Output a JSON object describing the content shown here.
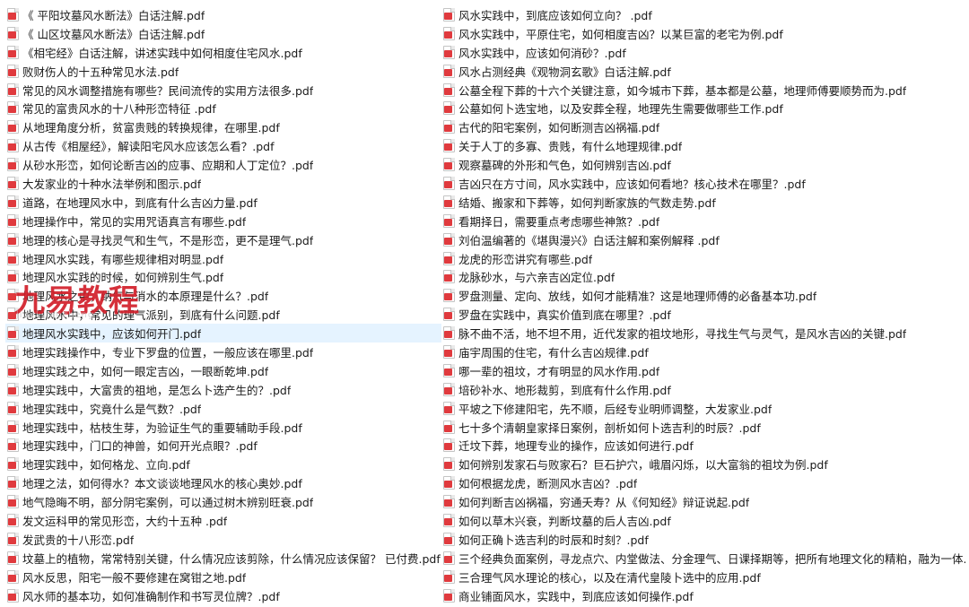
{
  "files": {
    "left": [
      "《 平阳坟墓风水断法》白话注解.pdf",
      "《 山区坟墓风水断法》白话注解.pdf",
      "《相宅经》白话注解，讲述实践中如何相度住宅风水.pdf",
      "败财伤人的十五种常见水法.pdf",
      "常见的风水调整措施有哪些？民间流传的实用方法很多.pdf",
      "常见的富贵风水的十八种形峦特征 .pdf",
      "从地理角度分析，贫富贵贱的转换规律，在哪里.pdf",
      "从古传《相屋经》，解读阳宅风水应该怎么看？.pdf",
      "从砂水形峦，如何论断吉凶的应事、应期和人丁定位？.pdf",
      "大发家业的十种水法举例和图示.pdf",
      "道路，在地理风水中，到底有什么吉凶力量.pdf",
      "地理操作中，常见的实用咒语真言有哪些.pdf",
      "地理的核心是寻找灵气和生气，不是形峦，更不是理气.pdf",
      "地理风水实践，有哪些规律相对明显.pdf",
      "地理风水实践的时候，如何辨别生气.pdf",
      "地理风水之中，纳气与消水的本原理是什么？.pdf",
      "地理风水中，常见的理气派别，到底有什么问题.pdf",
      "地理风水实践中，应该如何开门.pdf",
      "地理实践操作中，专业下罗盘的位置，一般应该在哪里.pdf",
      "地理实践之中，如何一眼定吉凶，一眼断乾坤.pdf",
      "地理实践中，大富贵的祖地，是怎么卜选产生的？.pdf",
      "地理实践中，究竟什么是气数？.pdf",
      "地理实践中，枯枝生芽，为验证生气的重要辅助手段.pdf",
      "地理实践中，门口的神兽，如何开光点眼？.pdf",
      "地理实践中，如何格龙、立向.pdf",
      "地理之法，如何得水？本文谈谈地理风水的核心奥妙.pdf",
      "地气隐晦不明，部分阴宅案例，可以通过树木辨别旺衰.pdf",
      "发文运科甲的常见形峦，大约十五种 .pdf",
      "发武贵的十八形峦.pdf",
      "坟墓上的植物，常常特别关键，什么情况应该剪除，什么情况应该保留？ 已付费.pdf",
      "风水反思，阳宅一般不要修建在窝钳之地.pdf",
      "风水师的基本功，如何准确制作和书写灵位牌？.pdf"
    ],
    "right": [
      "风水实践中，到底应该如何立向？ .pdf",
      "风水实践中，平原住宅，如何相度吉凶？以某巨富的老宅为例.pdf",
      "风水实践中，应该如何消砂？.pdf",
      "风水占测经典《观物洞玄歌》白话注解.pdf",
      "公墓全程下葬的十六个关键注意，如今城市下葬，基本都是公墓，地理师傅要顺势而为.pdf",
      "公墓如何卜选宝地，以及安葬全程，地理先生需要做哪些工作.pdf",
      "古代的阳宅案例，如何断测吉凶祸福.pdf",
      "关于人丁的多寡、贵贱，有什么地理规律.pdf",
      "观察墓碑的外形和气色，如何辨别吉凶.pdf",
      "吉凶只在方寸间，风水实践中，应该如何看地？核心技术在哪里？.pdf",
      "结婚、搬家和下葬等，如何判断家族的气数走势.pdf",
      "看期择日，需要重点考虑哪些神煞？.pdf",
      "刘伯温编著的《堪舆漫兴》白话注解和案例解释 .pdf",
      "龙虎的形峦讲究有哪些.pdf",
      "龙脉砂水，与六亲吉凶定位.pdf",
      "罗盘测量、定向、放线，如何才能精准？这是地理师傅的必备基本功.pdf",
      "罗盘在实践中，真实价值到底在哪里？.pdf",
      "脉不曲不活，地不坦不用，近代发家的祖坟地形，寻找生气与灵气，是风水吉凶的关键.pdf",
      "庙宇周围的住宅，有什么吉凶规律.pdf",
      "哪一辈的祖坟，才有明显的风水作用.pdf",
      "培砂补水、地形裁剪，到底有什么作用.pdf",
      "平坡之下修建阳宅，先不顺，后经专业明师调整，大发家业.pdf",
      "七十多个清朝皇家择日案例，剖析如何卜选吉利的时辰？.pdf",
      "迁坟下葬，地理专业的操作，应该如何进行.pdf",
      "如何辨别发家石与败家石？巨石护穴，峨眉闪烁，以大富翁的祖坟为例.pdf",
      "如何根据龙虎，断测风水吉凶？.pdf",
      "如何判断吉凶祸福，穷通夭寿？从《何知经》辩证说起.pdf",
      "如何以草木兴衰，判断坟墓的后人吉凶.pdf",
      "如何正确卜选吉利的时辰和时刻？.pdf",
      "三个经典负面案例，寻龙点穴、内堂做法、分金理气、日课择期等，把所有地理文化的精粕，融为一体.pdf",
      "三合理气风水理论的核心，以及在清代皇陵卜选中的应用.pdf",
      "商业铺面风水，实践中，到底应该如何操作.pdf"
    ]
  },
  "selected_file": "地理风水实践中，应该如何开门.pdf",
  "file_icon": "pdf-file-icon",
  "colors": {
    "pdf_red": "#e03a3e",
    "selection_bg": "#e5f3ff",
    "watermark_red": "#d21f2a"
  },
  "watermark": {
    "title": "九易教程",
    "subtitle": "jiuyi jiaocheng"
  }
}
